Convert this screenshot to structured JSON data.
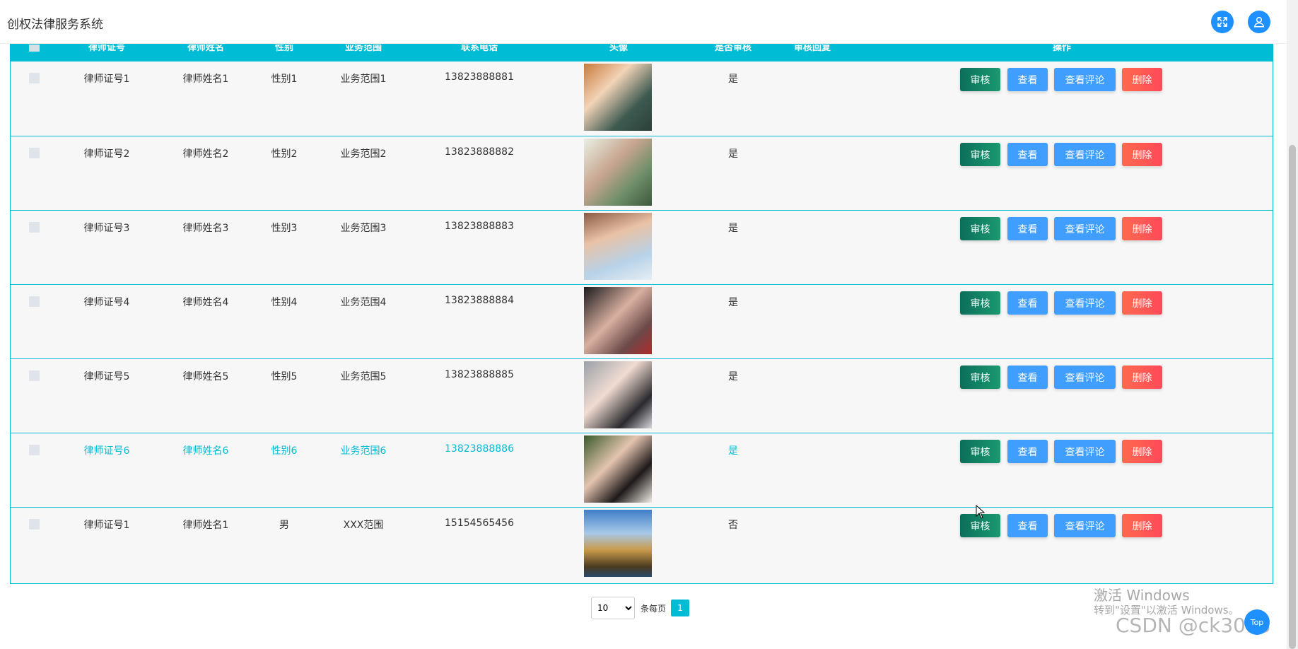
{
  "app": {
    "title": "创权法律服务系统"
  },
  "header_icons": {
    "fullscreen": "fullscreen-icon",
    "user": "user-icon"
  },
  "table": {
    "columns": [
      "律师证号",
      "律师姓名",
      "性别",
      "业务范围",
      "联系电话",
      "头像",
      "是否审核",
      "审核回复",
      "操作"
    ],
    "rows": [
      {
        "license": "律师证号1",
        "name": "律师姓名1",
        "gender": "性别1",
        "scope": "业务范围1",
        "phone": "13823888881",
        "audited": "是",
        "reply": ""
      },
      {
        "license": "律师证号2",
        "name": "律师姓名2",
        "gender": "性别2",
        "scope": "业务范围2",
        "phone": "13823888882",
        "audited": "是",
        "reply": ""
      },
      {
        "license": "律师证号3",
        "name": "律师姓名3",
        "gender": "性别3",
        "scope": "业务范围3",
        "phone": "13823888883",
        "audited": "是",
        "reply": ""
      },
      {
        "license": "律师证号4",
        "name": "律师姓名4",
        "gender": "性别4",
        "scope": "业务范围4",
        "phone": "13823888884",
        "audited": "是",
        "reply": ""
      },
      {
        "license": "律师证号5",
        "name": "律师姓名5",
        "gender": "性别5",
        "scope": "业务范围5",
        "phone": "13823888885",
        "audited": "是",
        "reply": ""
      },
      {
        "license": "律师证号6",
        "name": "律师姓名6",
        "gender": "性别6",
        "scope": "业务范围6",
        "phone": "13823888886",
        "audited": "是",
        "reply": ""
      },
      {
        "license": "律师证号1",
        "name": "律师姓名1",
        "gender": "男",
        "scope": "XXX范围",
        "phone": "15154565456",
        "audited": "否",
        "reply": ""
      }
    ],
    "actions": {
      "audit": "审核",
      "view": "查看",
      "review": "查看评论",
      "delete": "删除"
    }
  },
  "pager": {
    "page_size": "10",
    "per_page_label": "条每页",
    "current_page": "1"
  },
  "overlay": {
    "activate_title": "激活 Windows",
    "activate_hint": "转到\"设置\"以激活 Windows。",
    "csdn": "CSDN @ck3013",
    "top_label": "Top"
  },
  "colors": {
    "accent": "#00bcd4",
    "primary": "#409eff",
    "audit": "#0c6e5a",
    "danger": "#ff4a5a"
  }
}
